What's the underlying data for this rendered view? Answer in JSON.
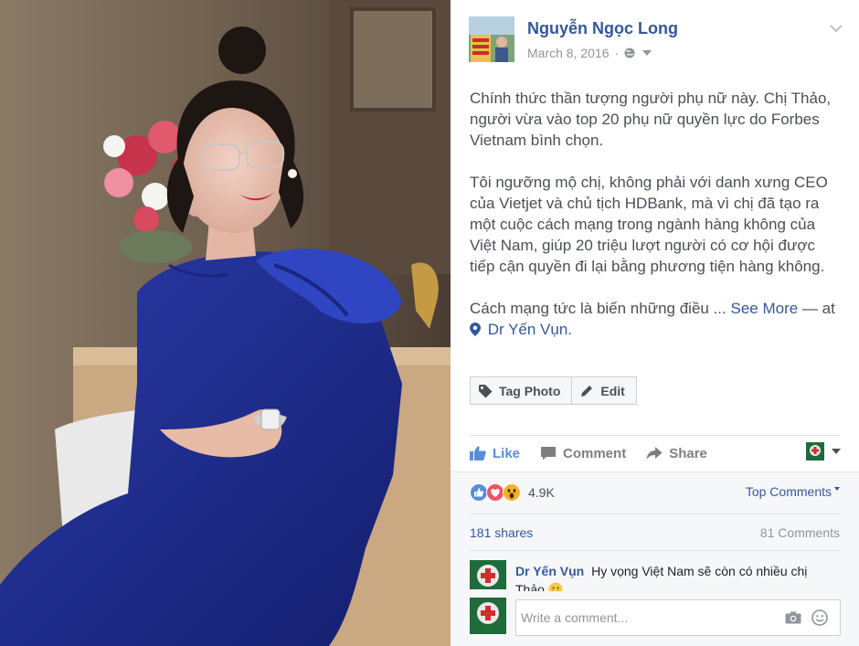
{
  "post": {
    "author": "Nguyễn Ngọc Long",
    "date": "March 8, 2016",
    "body_paragraph_1": "Chính thức thần tượng người phụ nữ này. Chị Thảo, người vừa vào top 20 phụ nữ quyền lực do Forbes Vietnam bình chọn.",
    "body_paragraph_2": "Tôi ngưỡng mộ chị, không phải với danh xưng CEO của Vietjet và chủ tịch HDBank, mà vì chị đã tạo ra một cuộc cách mạng trong ngành hàng không của Việt Nam, giúp 20 triệu lượt người có cơ hội được tiếp cận quyền đi lại bằng phương tiện hàng không.",
    "body_truncated": "Cách mạng tức là biến những điều ...",
    "see_more": "See More",
    "location_prefix": "— at",
    "location": "Dr Yến Vụn."
  },
  "photo_actions": {
    "tag_photo": "Tag Photo",
    "edit": "Edit"
  },
  "ufi": {
    "like": "Like",
    "comment": "Comment",
    "share": "Share"
  },
  "engagement": {
    "reactions_count": "4.9K",
    "top_comments": "Top Comments",
    "shares": "181 shares",
    "comments": "81 Comments"
  },
  "comments": [
    {
      "author": "Dr Yến Vụn",
      "text": "Hy vọng Việt Nam sẽ còn có nhiều chị Thảo"
    }
  ],
  "composer": {
    "placeholder": "Write a comment..."
  },
  "colors": {
    "link_blue": "#365899",
    "like_blue": "#598dd8",
    "muted_gray": "#90949c",
    "love_red": "#f25268",
    "haha_yellow": "#f7b125"
  }
}
